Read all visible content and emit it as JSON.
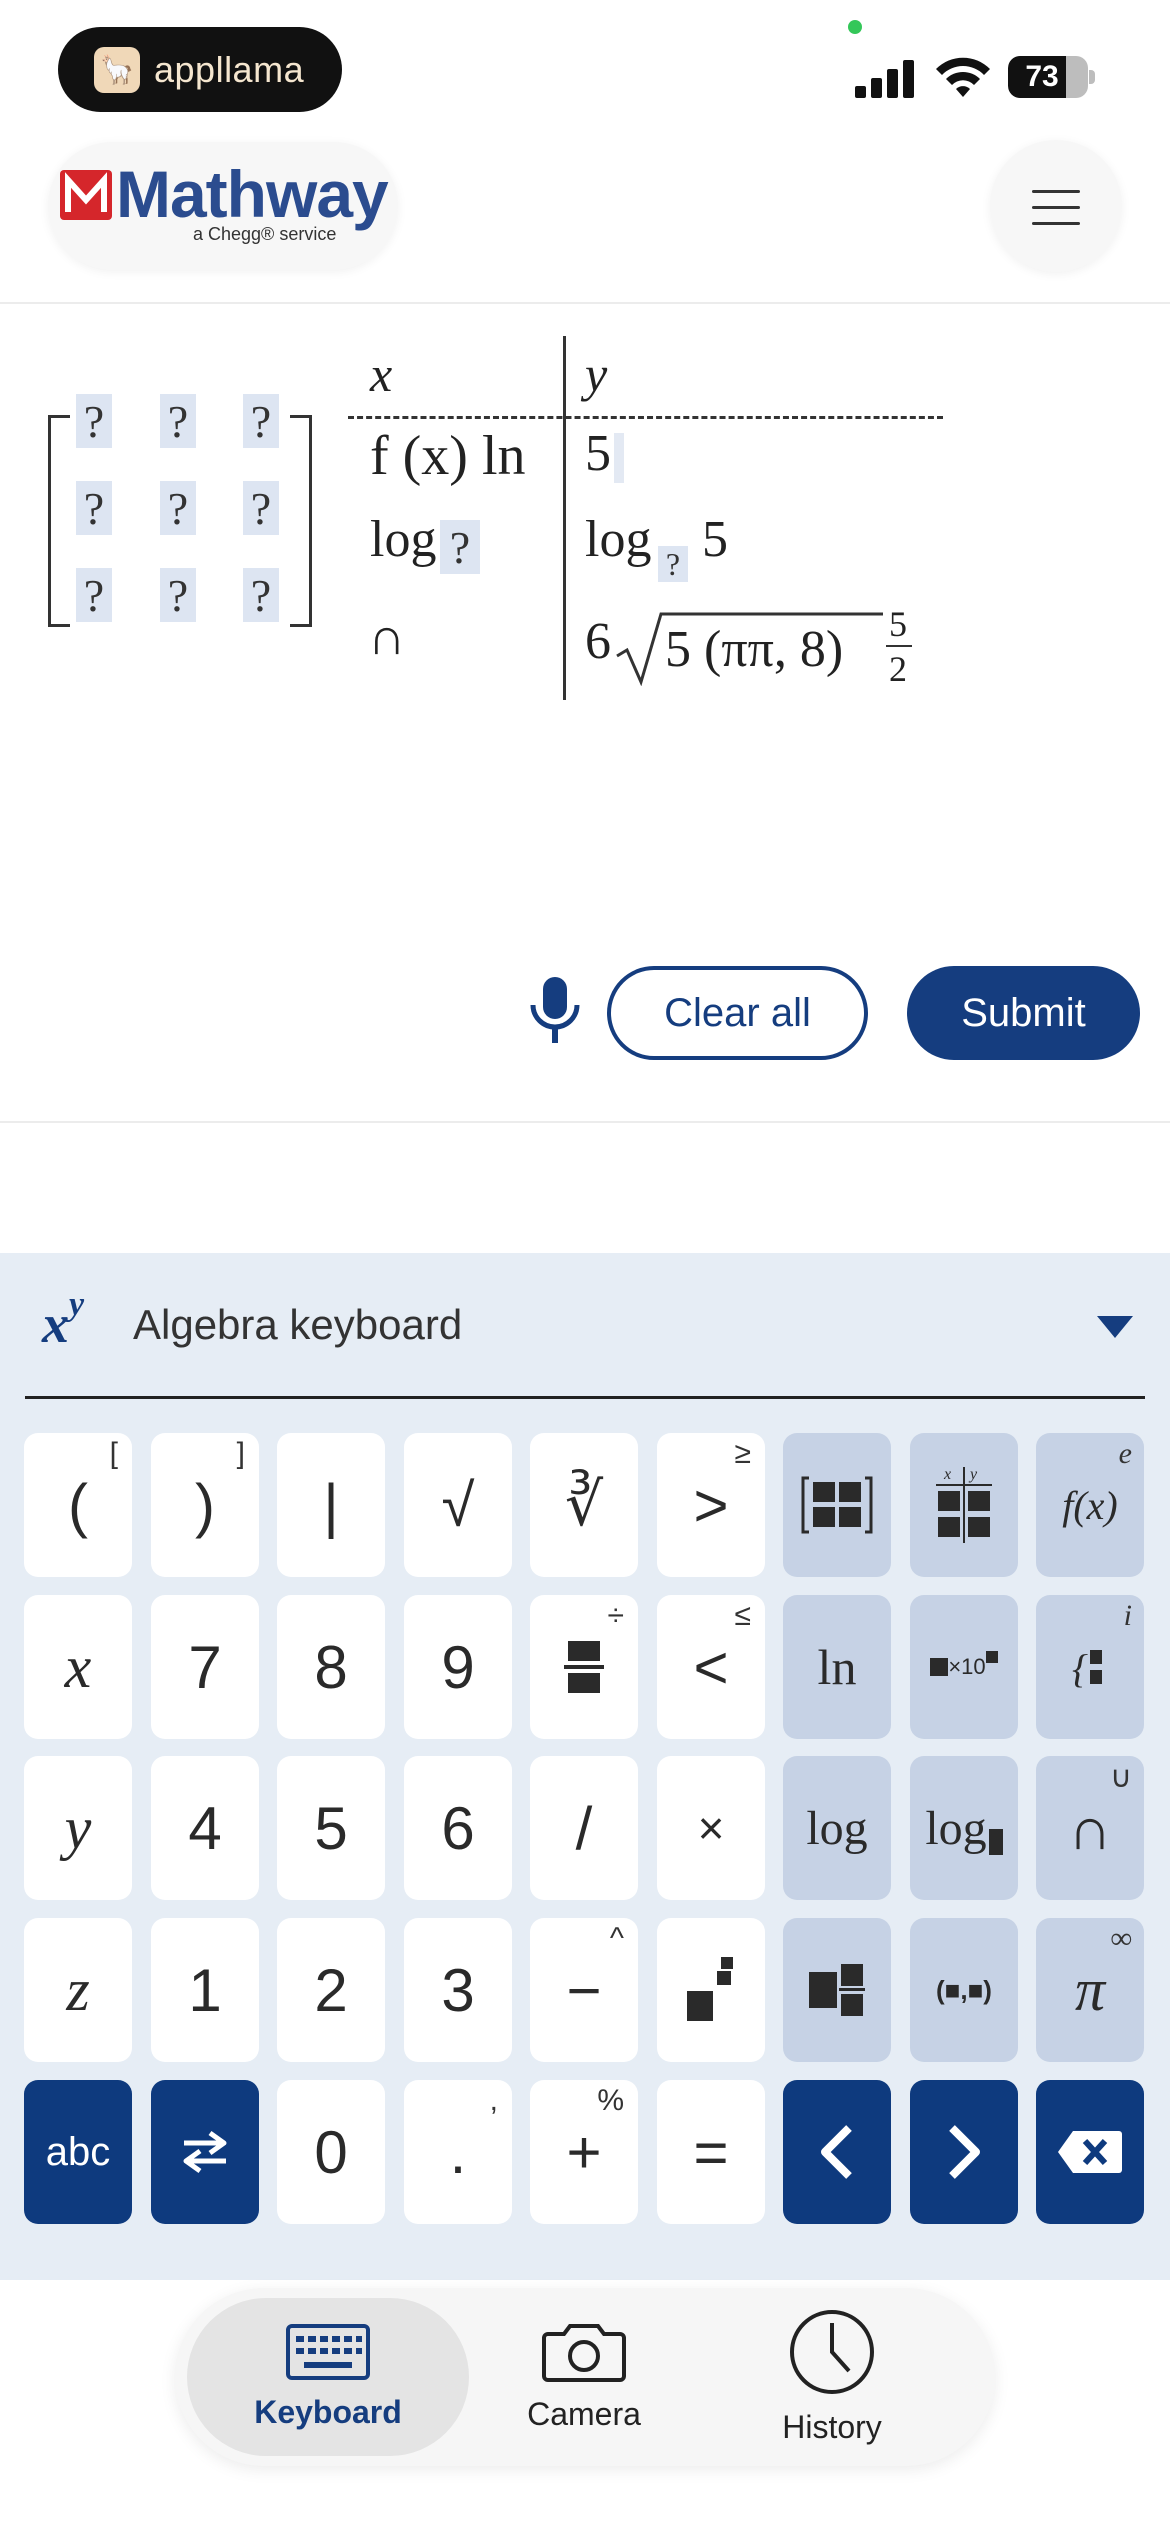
{
  "status_bar": {
    "app_pill": "appllama",
    "battery": "73",
    "battery_level": 0.73
  },
  "header": {
    "brand": "Mathway",
    "brand_sub": "a Chegg® service",
    "menu_icon": "hamburger-menu-icon"
  },
  "math_input": {
    "matrix_placeholder": "?",
    "table_headers": {
      "x": "x",
      "y": "y"
    },
    "rows": [
      {
        "x": "f (x) ln",
        "y": "5"
      },
      {
        "x": "log",
        "x_placeholder": "?",
        "y": "log",
        "y_sub": "?",
        "y_rest": "5"
      },
      {
        "x": "∩",
        "y_coef": "6",
        "y_radicand": "5 (ππ, 8)",
        "y_frac_num": "5",
        "y_frac_den": "2"
      }
    ]
  },
  "actions": {
    "mic_icon": "microphone-icon",
    "clear_label": "Clear all",
    "submit_label": "Submit"
  },
  "keyboard": {
    "title": "Algebra keyboard",
    "icon_base": "x",
    "icon_exp": "y",
    "rows": [
      [
        {
          "label": "(",
          "alt": "["
        },
        {
          "label": ")",
          "alt": "]"
        },
        {
          "label": "|"
        },
        {
          "label": "√"
        },
        {
          "label": "∛"
        },
        {
          "label": ">",
          "alt": "≥"
        },
        {
          "label": "matrix-icon"
        },
        {
          "label": "table-icon",
          "alt": "x|y"
        },
        {
          "label": "f(x)",
          "alt": "e"
        }
      ],
      [
        {
          "label": "x"
        },
        {
          "label": "7"
        },
        {
          "label": "8"
        },
        {
          "label": "9"
        },
        {
          "label": "fraction-icon",
          "alt": "÷"
        },
        {
          "label": "<",
          "alt": "≤"
        },
        {
          "label": "ln"
        },
        {
          "label": "scientific-notation-icon",
          "inner": "×10"
        },
        {
          "label": "piecewise-icon",
          "alt": "i"
        }
      ],
      [
        {
          "label": "y"
        },
        {
          "label": "4"
        },
        {
          "label": "5"
        },
        {
          "label": "6"
        },
        {
          "label": "/"
        },
        {
          "label": "×"
        },
        {
          "label": "log"
        },
        {
          "label": "log"
        },
        {
          "label": "∩",
          "alt": "∪"
        }
      ],
      [
        {
          "label": "z"
        },
        {
          "label": "1"
        },
        {
          "label": "2"
        },
        {
          "label": "3"
        },
        {
          "label": "−",
          "alt": "^"
        },
        {
          "label": "superscript-icon"
        },
        {
          "label": "mixed-number-icon"
        },
        {
          "label": "(■,■)"
        },
        {
          "label": "π",
          "alt": "∞"
        }
      ],
      [
        {
          "label": "abc"
        },
        {
          "label": "swap-icon"
        },
        {
          "label": "0"
        },
        {
          "label": ".",
          "alt": ","
        },
        {
          "label": "+",
          "alt": "%"
        },
        {
          "label": "="
        },
        {
          "label": "left-arrow-icon"
        },
        {
          "label": "right-arrow-icon"
        },
        {
          "label": "backspace-icon"
        }
      ]
    ]
  },
  "bottom_nav": {
    "tabs": [
      {
        "label": "Keyboard",
        "icon": "keyboard-icon",
        "active": true
      },
      {
        "label": "Camera",
        "icon": "camera-icon",
        "active": false
      },
      {
        "label": "History",
        "icon": "clock-icon",
        "active": false
      }
    ]
  }
}
